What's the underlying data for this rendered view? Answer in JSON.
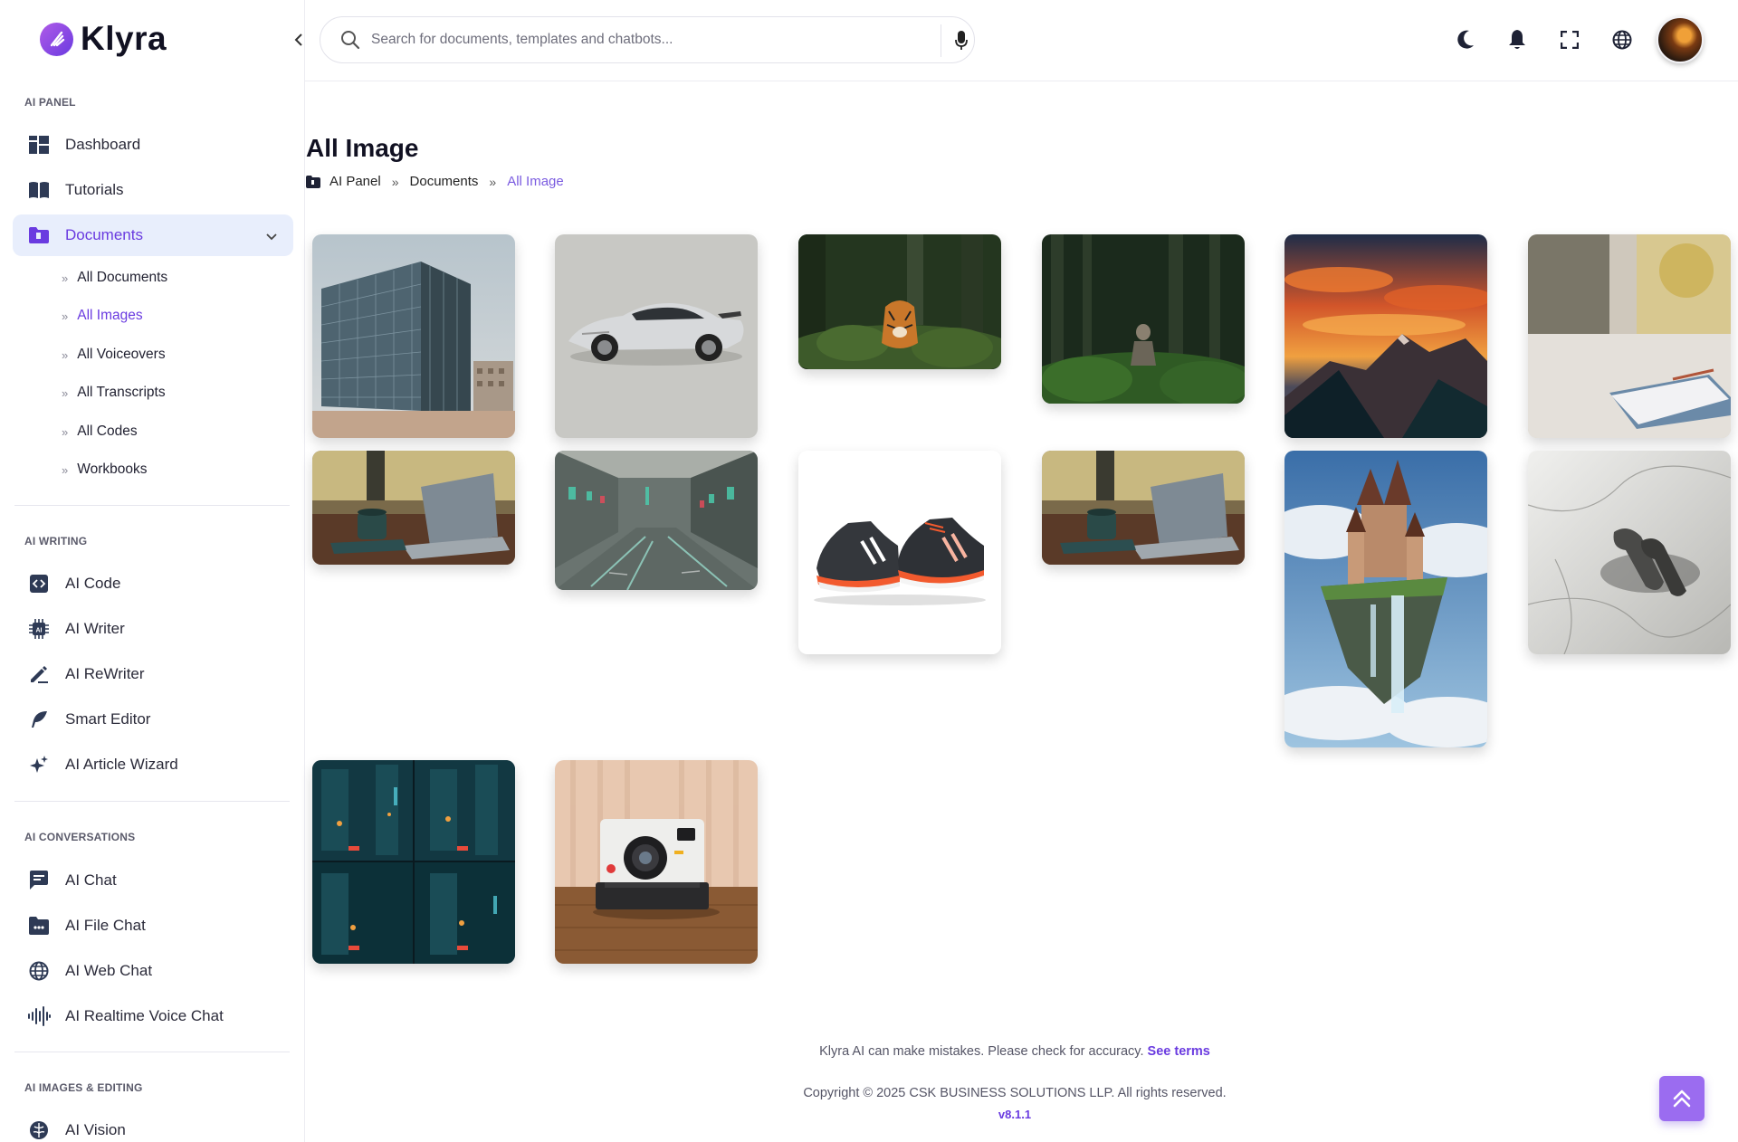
{
  "brand": {
    "name": "Klyra"
  },
  "search": {
    "placeholder": "Search for documents, templates and chatbots..."
  },
  "sidebar": {
    "sections": [
      {
        "title": "AI PANEL"
      },
      {
        "title": "AI WRITING"
      },
      {
        "title": "AI CONVERSATIONS"
      },
      {
        "title": "AI IMAGES & EDITING"
      }
    ],
    "panel_items": [
      {
        "label": "Dashboard",
        "icon": "dashboard-icon"
      },
      {
        "label": "Tutorials",
        "icon": "book-icon"
      },
      {
        "label": "Documents",
        "icon": "folder-icon",
        "active": true
      }
    ],
    "document_subitems": [
      {
        "label": "All Documents"
      },
      {
        "label": "All Images",
        "active": true
      },
      {
        "label": "All Voiceovers"
      },
      {
        "label": "All Transcripts"
      },
      {
        "label": "All Codes"
      },
      {
        "label": "Workbooks"
      }
    ],
    "writing_items": [
      {
        "label": "AI Code",
        "icon": "code-icon"
      },
      {
        "label": "AI Writer",
        "icon": "chip-icon"
      },
      {
        "label": "AI ReWriter",
        "icon": "pen-icon"
      },
      {
        "label": "Smart Editor",
        "icon": "feather-icon"
      },
      {
        "label": "AI Article Wizard",
        "icon": "sparkles-icon"
      }
    ],
    "conversation_items": [
      {
        "label": "AI Chat",
        "icon": "chat-icon"
      },
      {
        "label": "AI File Chat",
        "icon": "file-chat-icon"
      },
      {
        "label": "AI Web Chat",
        "icon": "globe-icon"
      },
      {
        "label": "AI Realtime Voice Chat",
        "icon": "waveform-icon"
      }
    ],
    "images_items": [
      {
        "label": "AI Vision",
        "icon": "brain-icon"
      }
    ]
  },
  "header": {
    "icons": [
      "moon-icon",
      "bell-icon",
      "fullscreen-icon",
      "globe-icon",
      "avatar"
    ]
  },
  "main": {
    "title": "All Image",
    "breadcrumb": [
      "AI Panel",
      "Documents",
      "All Image"
    ],
    "images": [
      {
        "subject": "glass office building"
      },
      {
        "subject": "silver sports car"
      },
      {
        "subject": "tiger in forest"
      },
      {
        "subject": "person in forest"
      },
      {
        "subject": "mountain sunset"
      },
      {
        "subject": "notebook on desk"
      },
      {
        "subject": "laptop and mug on desk"
      },
      {
        "subject": "rainy city street"
      },
      {
        "subject": "running sneakers"
      },
      {
        "subject": "laptop and mug on desk"
      },
      {
        "subject": "floating castle with waterfall"
      },
      {
        "subject": "earbuds on marble"
      },
      {
        "subject": "neon city night"
      },
      {
        "subject": "instant camera"
      }
    ]
  },
  "footer": {
    "note": "Klyra AI can make mistakes. Please check for accuracy.",
    "terms_link": "See terms",
    "copyright": "Copyright © 2025 CSK BUSINESS SOLUTIONS LLP. All rights reserved.",
    "version": "v8.1.1"
  },
  "colors": {
    "accent": "#6a3be0",
    "active_bg": "#e8eefc"
  }
}
